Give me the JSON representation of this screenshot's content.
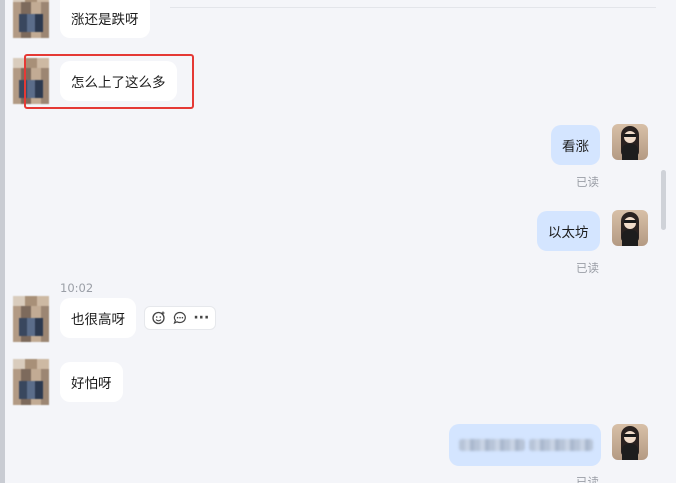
{
  "messages": [
    {
      "id": "m1",
      "side": "in",
      "text": "涨还是跌呀"
    },
    {
      "id": "m2",
      "side": "in",
      "text": "怎么上了这么多"
    },
    {
      "id": "m3",
      "side": "out",
      "text": "看涨",
      "status": "已读"
    },
    {
      "id": "m4",
      "side": "out",
      "text": "以太坊",
      "status": "已读"
    },
    {
      "id": "m5",
      "side": "in",
      "text": "也很高呀",
      "time": "10:02"
    },
    {
      "id": "m6",
      "side": "in",
      "text": "好怕呀"
    },
    {
      "id": "m7",
      "side": "out",
      "text": "",
      "status": "已读",
      "obscured": true
    }
  ],
  "message_actions": {
    "icons": [
      "emoji-reaction-icon",
      "reply-comment-icon",
      "more-dots-icon"
    ],
    "more_label": "···"
  },
  "colors": {
    "background": "#f4f5f9",
    "incoming_bubble": "#ffffff",
    "outgoing_bubble": "#d4e5ff",
    "highlight_border": "#e53935",
    "meta_text": "#9a9ea6"
  }
}
